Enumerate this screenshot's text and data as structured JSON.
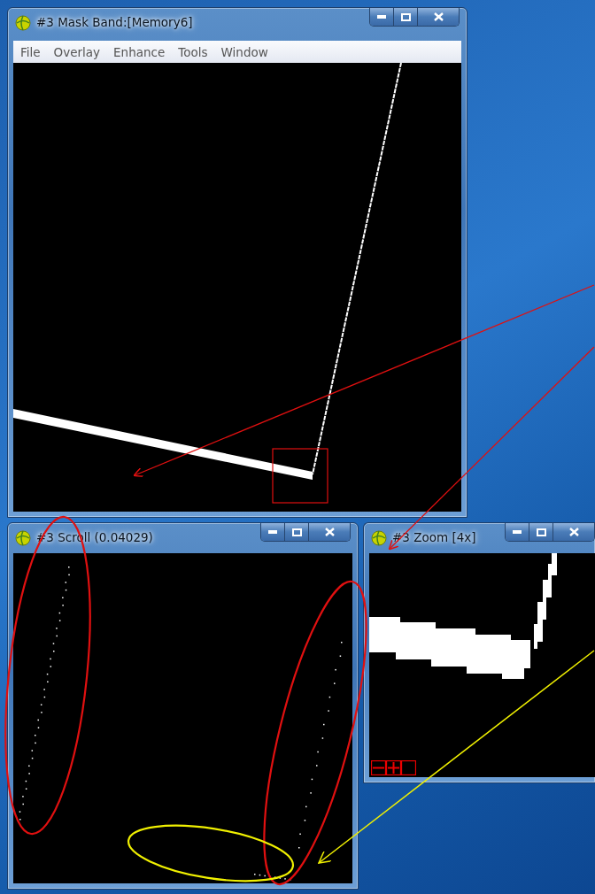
{
  "windows": [
    {
      "kind": "mask",
      "title": "#3 Mask Band:[Memory6]",
      "menu": [
        "File",
        "Overlay",
        "Enhance",
        "Tools",
        "Window"
      ]
    },
    {
      "kind": "scroll",
      "title": "#3 Scroll (0.04029)"
    },
    {
      "kind": "zoom",
      "title": "#3 Zoom [4x]"
    }
  ]
}
